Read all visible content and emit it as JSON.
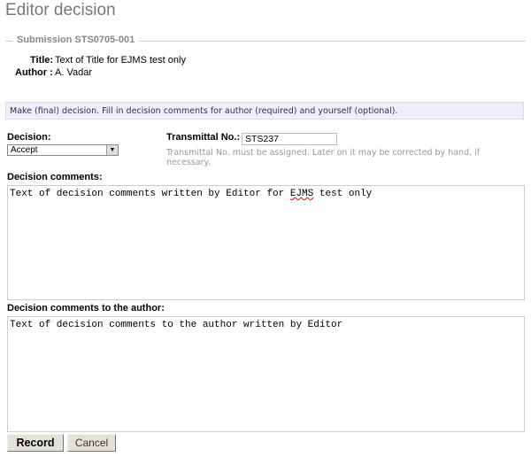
{
  "page_title": "Editor decision",
  "submission": {
    "legend": "Submission STS0705-001",
    "title_label": "Title:",
    "title": "Text of Title for EJMS test only",
    "author_label": "Author :",
    "author": "A. Vadar"
  },
  "info": "Make (final) decision. Fill in decision comments for author (required) and yourself (optional).",
  "form": {
    "decision_label": "Decision:",
    "decision_value": "Accept",
    "transmittal_label": "Transmittal No.:",
    "transmittal_value": "STS237",
    "transmittal_help": "Transmittal No. must be assigned. Later on it may be corrected by hand, if necessary.",
    "comments_label": "Decision comments:",
    "comments_before": "Text of decision comments written by Editor for ",
    "comments_misspelled": "EJMS",
    "comments_after": " test only",
    "author_comments_label": "Decision comments to the author:",
    "author_comments": "Text of decision comments to the author written by Editor"
  },
  "buttons": {
    "record": "Record",
    "cancel": "Cancel"
  }
}
